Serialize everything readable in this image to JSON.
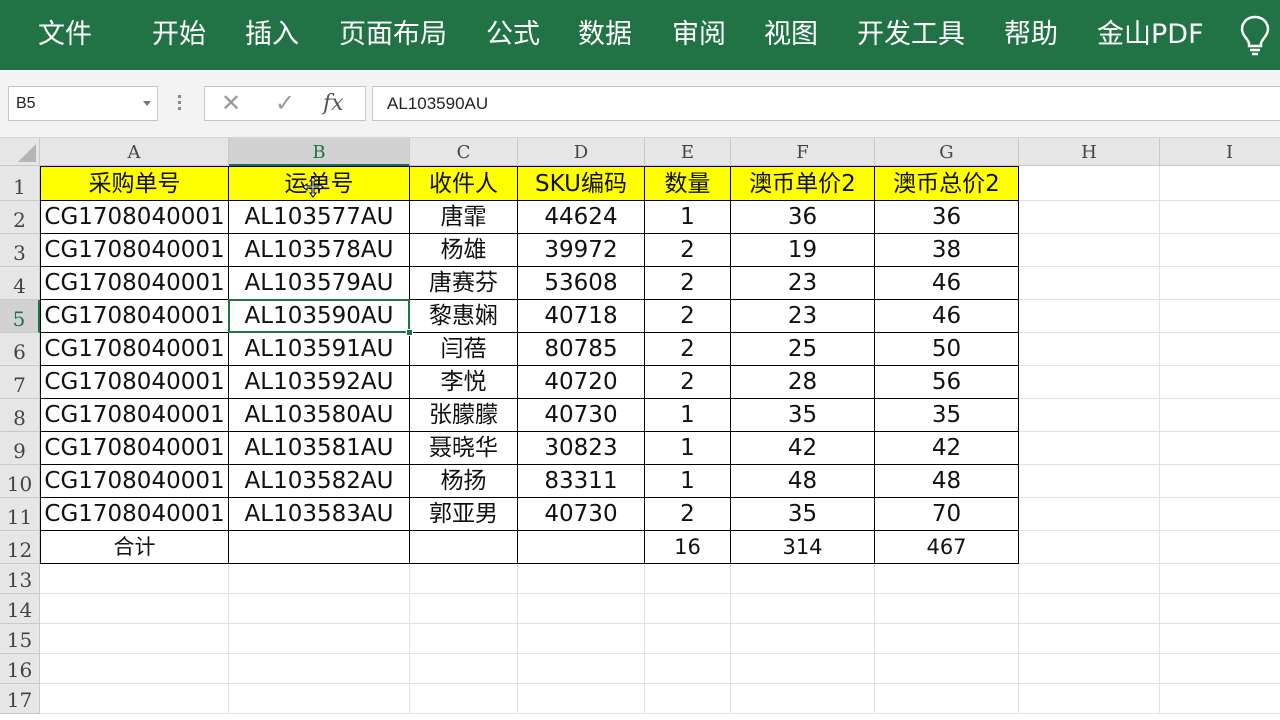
{
  "ribbon": {
    "tabs": [
      "文件",
      "开始",
      "插入",
      "页面布局",
      "公式",
      "数据",
      "审阅",
      "视图",
      "开发工具",
      "帮助",
      "金山PDF"
    ],
    "bulb_icon": "lightbulb-icon",
    "bg_color": "#217346"
  },
  "formula_bar": {
    "name_box": "B5",
    "cancel_symbol": "✕",
    "enter_symbol": "✓",
    "fx_label": "fx",
    "formula": "AL103590AU"
  },
  "columns": [
    "A",
    "B",
    "C",
    "D",
    "E",
    "F",
    "G",
    "H",
    "I"
  ],
  "rows": [
    "1",
    "2",
    "3",
    "4",
    "5",
    "6",
    "7",
    "8",
    "9",
    "10",
    "11",
    "12",
    "13",
    "14",
    "15",
    "16",
    "17"
  ],
  "table": {
    "header": [
      "采购单号",
      "运单号",
      "收件人",
      "SKU编码",
      "数量",
      "澳币单价2",
      "澳币总价2"
    ],
    "data": [
      [
        "CG1708040001",
        "AL103577AU",
        "唐霏",
        "44624",
        "1",
        "36",
        "36"
      ],
      [
        "CG1708040001",
        "AL103578AU",
        "杨雄",
        "39972",
        "2",
        "19",
        "38"
      ],
      [
        "CG1708040001",
        "AL103579AU",
        "唐赛芬",
        "53608",
        "2",
        "23",
        "46"
      ],
      [
        "CG1708040001",
        "AL103590AU",
        "黎惠娴",
        "40718",
        "2",
        "23",
        "46"
      ],
      [
        "CG1708040001",
        "AL103591AU",
        "闫蓓",
        "80785",
        "2",
        "25",
        "50"
      ],
      [
        "CG1708040001",
        "AL103592AU",
        "李悦",
        "40720",
        "2",
        "28",
        "56"
      ],
      [
        "CG1708040001",
        "AL103580AU",
        "张朦朦",
        "40730",
        "1",
        "35",
        "35"
      ],
      [
        "CG1708040001",
        "AL103581AU",
        "聂晓华",
        "30823",
        "1",
        "42",
        "42"
      ],
      [
        "CG1708040001",
        "AL103582AU",
        "杨扬",
        "83311",
        "1",
        "48",
        "48"
      ],
      [
        "CG1708040001",
        "AL103583AU",
        "郭亚男",
        "40730",
        "2",
        "35",
        "70"
      ]
    ],
    "total": [
      "合计",
      "",
      "",
      "",
      "16",
      "314",
      "467"
    ]
  },
  "selected": {
    "cell": "B5",
    "col": "B",
    "row": "5"
  },
  "colors": {
    "header_fill": "#ffff00",
    "selection": "#217346"
  }
}
